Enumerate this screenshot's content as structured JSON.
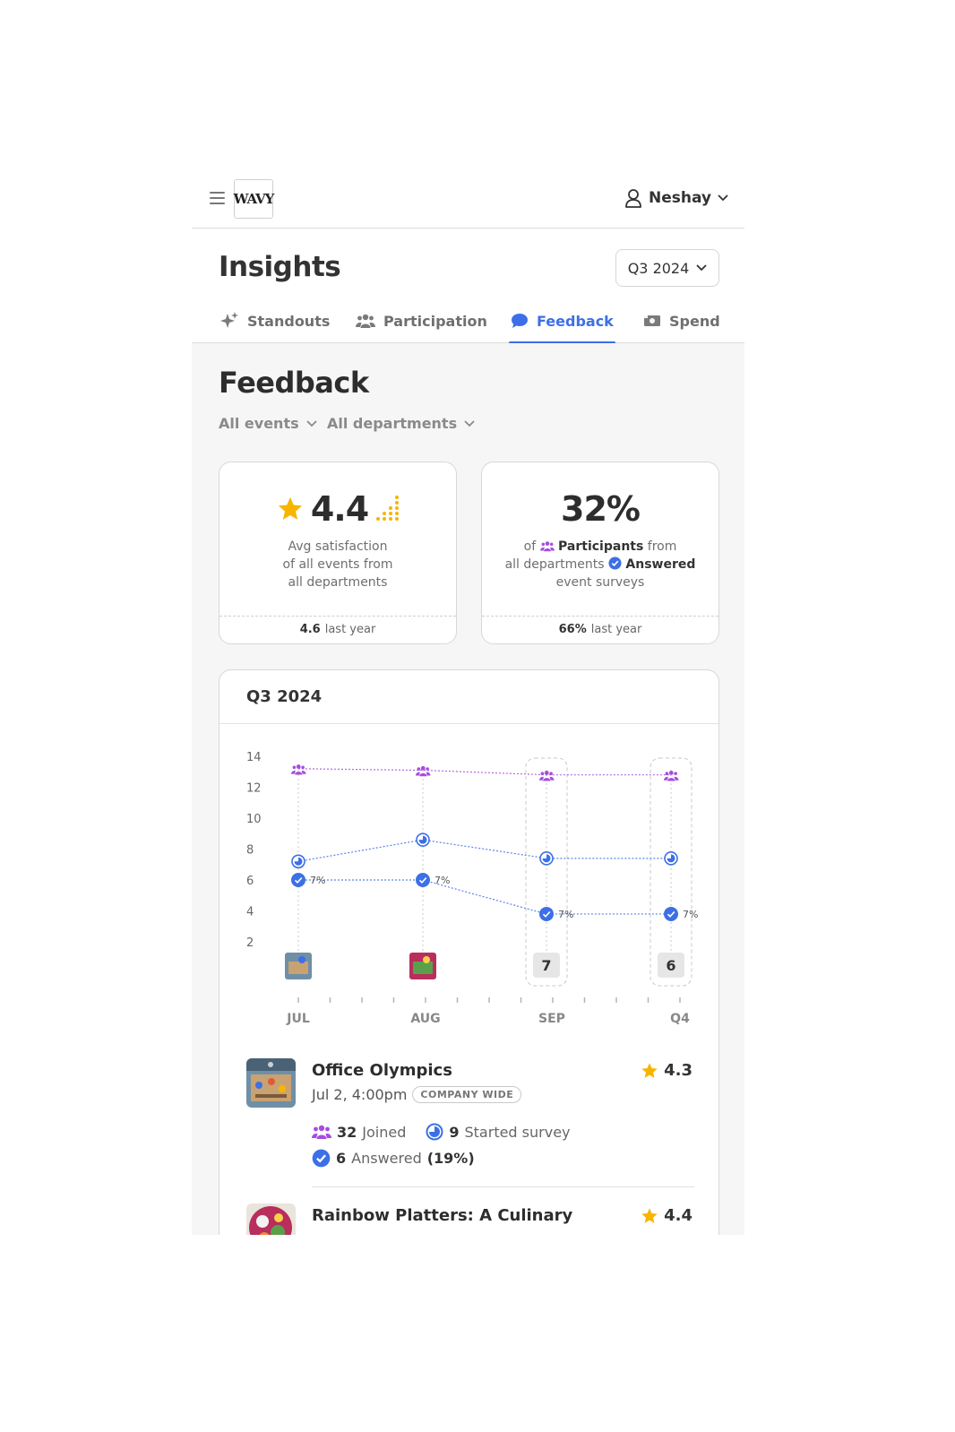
{
  "app": {
    "logo_text": "WAVY",
    "user_name": "Neshay"
  },
  "header": {
    "title": "Insights",
    "quarter_select": "Q3 2024"
  },
  "tabs": [
    {
      "label": "Standouts",
      "icon": "sparkles-icon"
    },
    {
      "label": "Participation",
      "icon": "people-icon"
    },
    {
      "label": "Feedback",
      "icon": "chat-bubble-icon",
      "active": true
    },
    {
      "label": "Spend",
      "icon": "cash-icon"
    }
  ],
  "feedback": {
    "title": "Feedback",
    "filters": {
      "events": "All events",
      "departments": "All departments"
    },
    "satisfaction": {
      "value": "4.4",
      "desc_lines": [
        "Avg satisfaction",
        "of all events from",
        "all departments"
      ],
      "last_year_value": "4.6",
      "last_year_suffix": "last year"
    },
    "participation": {
      "value": "32%",
      "of": "of",
      "participants": "Participants",
      "from": "from",
      "all_departments": "all departments",
      "answered": "Answered",
      "event_surveys": "event surveys",
      "last_year_value": "66%",
      "last_year_suffix": "last year"
    }
  },
  "chart": {
    "title": "Q3 2024",
    "colors": {
      "joined": "#a64de0",
      "started": "#3d6fe6",
      "answered": "#3d6fe6"
    }
  },
  "chart_data": {
    "type": "line",
    "categories": [
      "JUL",
      "AUG",
      "SEP",
      "Q4"
    ],
    "ylim": [
      0,
      14
    ],
    "yticks": [
      2,
      4,
      6,
      8,
      10,
      12,
      14
    ],
    "series": [
      {
        "name": "Participants",
        "values": [
          13.2,
          13.1,
          12.8,
          12.8
        ]
      },
      {
        "name": "Started survey",
        "values": [
          7.2,
          8.6,
          7.4,
          7.4
        ]
      },
      {
        "name": "Answered",
        "values": [
          6.0,
          6.0,
          3.8,
          3.8
        ]
      }
    ],
    "point_labels": [
      "7%",
      "7%",
      "7%",
      "7%"
    ],
    "event_counts": [
      "",
      "",
      "7",
      "6"
    ]
  },
  "events": [
    {
      "title": "Office Olympics",
      "rating": "4.3",
      "date": "Jul 2, 4:00pm",
      "tag": "COMPANY WIDE",
      "joined": "32",
      "joined_label": "Joined",
      "started": "9",
      "started_label": "Started survey",
      "answered": "6",
      "answered_label": "Answered",
      "answered_pct": "(19%)"
    },
    {
      "title": "Rainbow Platters: A Culinary",
      "rating": "4.4"
    }
  ]
}
